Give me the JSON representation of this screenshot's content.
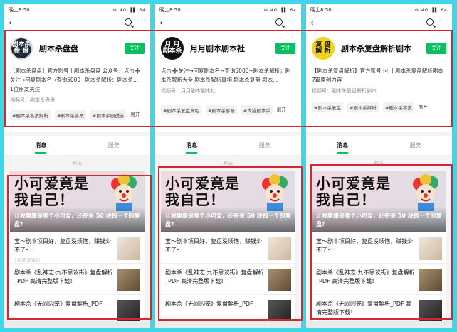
{
  "status": {
    "time": "晚上8:50",
    "right": "⚙ 4G ▐▌ 64"
  },
  "phones": [
    {
      "avatar_text": [
        "剧本杀",
        "盘 盘"
      ],
      "name": "剧本杀盘盘",
      "follow": "关注",
      "desc": "【剧本杀盘盘】官方账号丨剧本杀盘盘 公众号：点击➕关注→回复剧本名→查询5000+剧本杀解析：剧本杀...",
      "extra": "1位朋友关注",
      "video": "视频号：剧本杀盘盘",
      "tags": [
        "#剧本杀答案解析",
        "#剧本杀答案",
        "#剧本杀剧透答",
        "展开"
      ],
      "tab_msg": "消息",
      "tab_service": "服务",
      "date": "昨天",
      "banner_big": "小可爱竟是我自己！",
      "banner_title": "让我康康是哪个小可爱，还在买 50 块钱一个的复盘？",
      "items": [
        {
          "text": "宝～剧本项目好，复盘没烦恼，赚钱少不了～",
          "sub": "1位朋友读过"
        },
        {
          "text": "剧本杀《乱神志·九不思议街》复盘解析_PDF 高清完整版下载！",
          "sub": ""
        },
        {
          "text": "剧本杀《无间囚笼》复盘解析_PDF",
          "sub": ""
        }
      ]
    },
    {
      "avatar_text": [
        "月 月",
        "剧本杀"
      ],
      "name": "月月剧本剧本社",
      "follow": "关注",
      "desc": "点击➕关注→回复剧本名→查询5000+剧本杀解析；剧本杀解析大全 剧本杀解析真相 剧本杀复盘 剧本...",
      "extra": "",
      "video": "视频号：月月剧本剧本社",
      "tags": [
        "#剧本杀复盘真相",
        "#剧本杀解析",
        "#大猫剧本杀",
        "展开"
      ],
      "tab_msg": "消息",
      "tab_service": "服务",
      "date": "昨天",
      "banner_big": "小可爱竟是我自己！",
      "banner_title": "让我康康是哪个小可爱，还在买 50 块钱一个的复盘？",
      "items": [
        {
          "text": "宝～剧本项目好，复盘没烦恼，赚钱少不了～",
          "sub": ""
        },
        {
          "text": "剧本杀《乱神志·九不思议街》复盘解析_PDF 高清完整版下载！",
          "sub": ""
        },
        {
          "text": "剧本杀《无间囚笼》复盘解析_PDF",
          "sub": ""
        }
      ]
    },
    {
      "avatar_text": [
        "复 盘",
        "解 析"
      ],
      "name": "剧本杀复盘解析剧本",
      "follow": "关注",
      "desc": "【剧本杀复盘解析】官方账号 ⓥ 丨剧本杀复盘解析剧本 公众号...",
      "extra": "7篇原创内容",
      "video": "视频号：剧本杀复盘解析剧本",
      "tags": [
        "#剧本杀复盘",
        "#剧本杀解析",
        "#剧本杀答案",
        "展开"
      ],
      "tab_msg": "消息",
      "tab_service": "服务",
      "date": "昨天",
      "banner_big": "小可爱竟是我自己！",
      "banner_title": "让我康康是哪个小可爱，还在买 50 块钱一个的复盘？",
      "items": [
        {
          "text": "宝～剧本项目好，复盘没烦恼，赚钱少不了～",
          "sub": ""
        },
        {
          "text": "剧本杀《乱神志·九不思议街》复盘解析_PDF 高清完整版下载！",
          "sub": ""
        },
        {
          "text": "剧本杀《无间囚笼》复盘解析_PDF 高清完整版下载！",
          "sub": ""
        }
      ]
    }
  ],
  "colors": {
    "accent": "#07c160",
    "highlight_box": "#d9262e",
    "background": "#3fd6e6"
  }
}
